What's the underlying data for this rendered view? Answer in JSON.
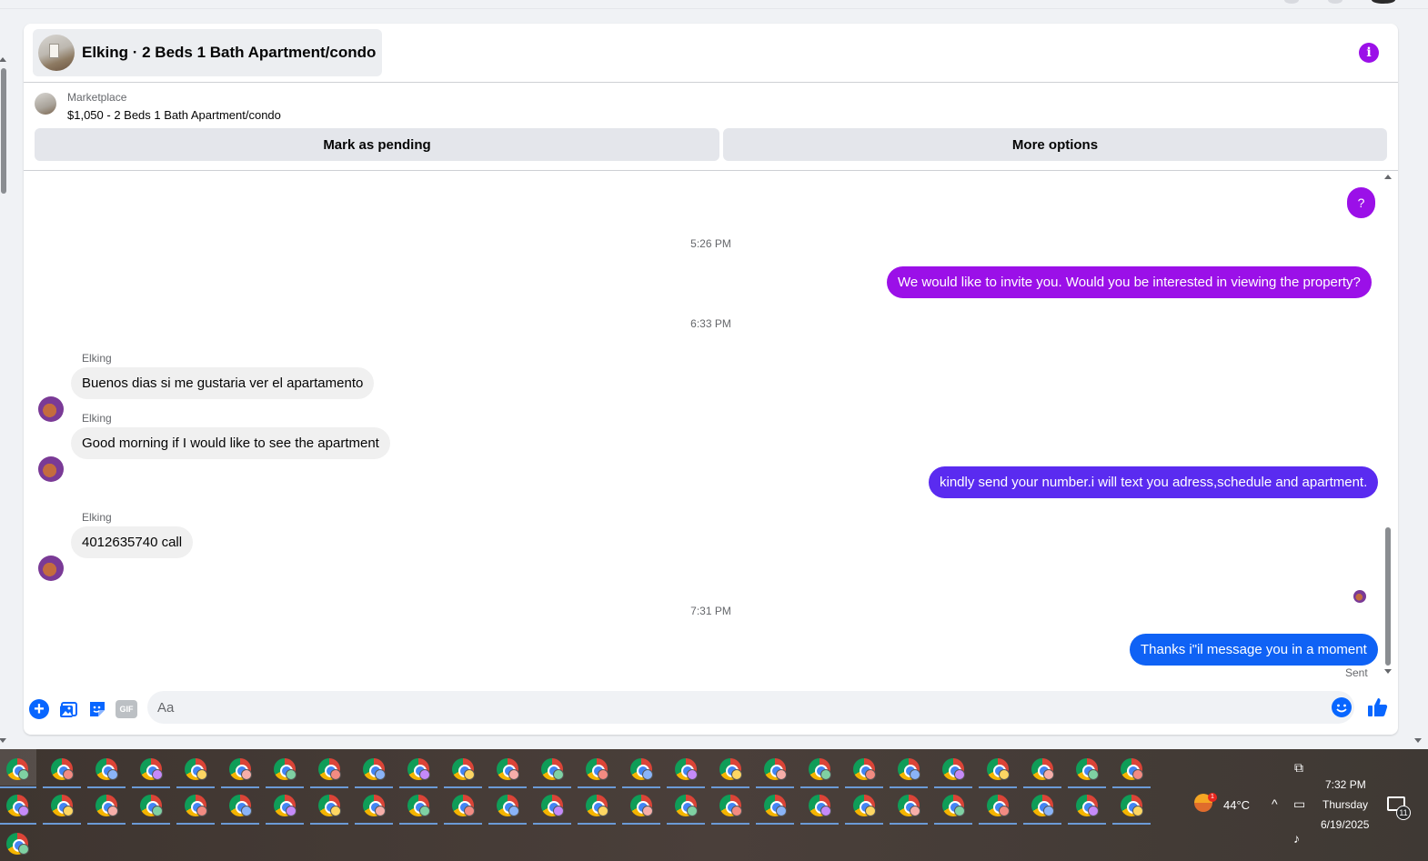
{
  "header": {
    "title": "Elking · 2 Beds 1 Bath Apartment/condo"
  },
  "listing": {
    "source": "Marketplace",
    "description": "$1,050 - 2 Beds 1 Bath Apartment/condo",
    "mark_pending_label": "Mark as pending",
    "more_options_label": "More options"
  },
  "thread": {
    "unknown_bubble": "?",
    "messages": [
      {
        "type": "time",
        "text": "5:26 PM"
      },
      {
        "type": "out",
        "text": "We would like to invite you. Would you be interested in viewing the property?",
        "color": "#9b10e8"
      },
      {
        "type": "time",
        "text": "6:33 PM"
      },
      {
        "type": "in",
        "sender": "Elking",
        "text": "Buenos dias si me gustaria ver el apartamento"
      },
      {
        "type": "in",
        "sender": "Elking",
        "text": "Good morning if I would like to see the apartment"
      },
      {
        "type": "out",
        "text": "kindly send your number.i will text you adress,schedule and apartment.",
        "color": "#5a2bf0"
      },
      {
        "type": "in",
        "sender": "Elking",
        "text": "4012635740 call"
      },
      {
        "type": "time",
        "text": "7:31 PM"
      },
      {
        "type": "out",
        "text": "Thanks i\"il message you in a moment",
        "color": "#0f62f5"
      }
    ],
    "status": "Sent"
  },
  "composer": {
    "placeholder": "Aa",
    "gif_label": "GIF",
    "icons": [
      "plus-icon",
      "image-icon",
      "sticker-icon",
      "gif-icon",
      "emoji-icon",
      "like-icon"
    ],
    "accent": "#0866ff"
  },
  "taskbar": {
    "temperature": "44°C",
    "weather_badge": "1",
    "time": "7:32 PM",
    "day": "Thursday",
    "date": "6/19/2025",
    "notification_count": "11"
  },
  "colors": {
    "purple_accent": "#9b10e8",
    "messenger_blue": "#0866ff"
  }
}
